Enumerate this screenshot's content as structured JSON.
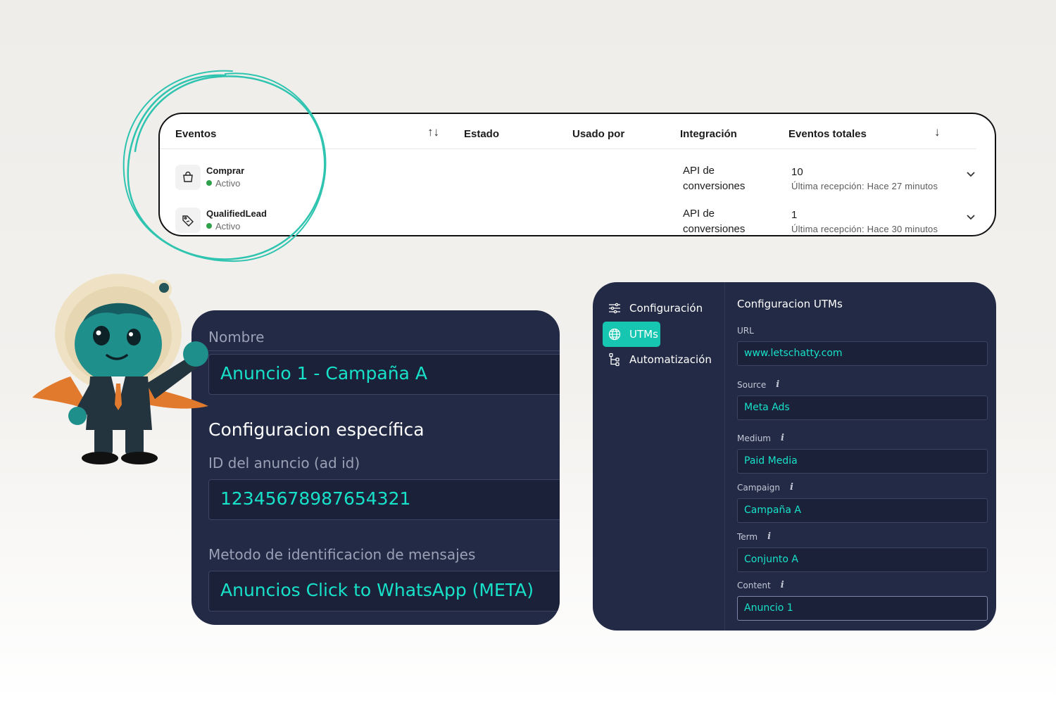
{
  "events_table": {
    "columns": [
      "Eventos",
      "Estado",
      "Usado por",
      "Integración",
      "Eventos totales"
    ],
    "rows": [
      {
        "name": "Comprar",
        "status": "Activo",
        "integration": "API de conversiones",
        "total": "10",
        "last_reception": "Última recepción: Hace 27 minutos",
        "icon": "shopping-bag-icon"
      },
      {
        "name": "QualifiedLead",
        "status": "Activo",
        "integration": "API de conversiones",
        "total": "1",
        "last_reception": "Última recepción: Hace 30 minutos",
        "icon": "tag-icon"
      }
    ],
    "status_color": "#2fa04b"
  },
  "ad_config": {
    "name_label": "Nombre",
    "name_value": "Anuncio 1 - Campaña A",
    "section_title": "Configuracion específica",
    "ad_id_label": "ID del anuncio (ad id)",
    "ad_id_value": "12345678987654321",
    "method_label": "Metodo de identificacion de mensajes",
    "method_value": "Anuncios Click to WhatsApp (META)"
  },
  "utm_panel": {
    "nav": [
      {
        "label": "Configuración",
        "icon": "sliders-icon",
        "active": false
      },
      {
        "label": "UTMs",
        "icon": "globe-icon",
        "active": true
      },
      {
        "label": "Automatización",
        "icon": "flow-icon",
        "active": false
      }
    ],
    "title": "Configuracion UTMs",
    "fields": [
      {
        "label": "URL",
        "value": "www.letschatty.com",
        "info": false
      },
      {
        "label": "Source",
        "value": "Meta Ads",
        "info": true
      },
      {
        "label": "Medium",
        "value": "Paid Media",
        "info": true
      },
      {
        "label": "Campaign",
        "value": "Campaña A",
        "info": true
      },
      {
        "label": "Term",
        "value": "Conjunto A",
        "info": true
      },
      {
        "label": "Content",
        "value": "Anuncio 1",
        "info": true
      }
    ],
    "accent_color": "#18e1c9"
  },
  "colors": {
    "panel_bg": "#222a45",
    "accent": "#18e1c9",
    "scribble": "#2ec4b0"
  }
}
